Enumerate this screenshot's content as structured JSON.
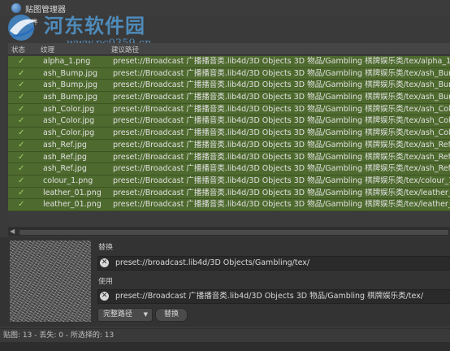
{
  "window": {
    "title": "贴图管理器",
    "menu": "文件"
  },
  "watermark": {
    "title": "河东软件园",
    "url": "www.pc0359.cn"
  },
  "table": {
    "columns": [
      "状态",
      "纹理",
      "建议路径"
    ],
    "rows": [
      {
        "file": "alpha_1.png",
        "path": "preset://Broadcast 广播播音类.lib4d/3D Objects 3D 物品/Gambling 棋牌娱乐类/tex/alpha_1.p"
      },
      {
        "file": "ash_Bump.jpg",
        "path": "preset://Broadcast 广播播音类.lib4d/3D Objects 3D 物品/Gambling 棋牌娱乐类/tex/ash_Bump"
      },
      {
        "file": "ash_Bump.jpg",
        "path": "preset://Broadcast 广播播音类.lib4d/3D Objects 3D 物品/Gambling 棋牌娱乐类/tex/ash_Bump"
      },
      {
        "file": "ash_Bump.jpg",
        "path": "preset://Broadcast 广播播音类.lib4d/3D Objects 3D 物品/Gambling 棋牌娱乐类/tex/ash_Bump"
      },
      {
        "file": "ash_Color.jpg",
        "path": "preset://Broadcast 广播播音类.lib4d/3D Objects 3D 物品/Gambling 棋牌娱乐类/tex/ash_Color"
      },
      {
        "file": "ash_Color.jpg",
        "path": "preset://Broadcast 广播播音类.lib4d/3D Objects 3D 物品/Gambling 棋牌娱乐类/tex/ash_Color"
      },
      {
        "file": "ash_Color.jpg",
        "path": "preset://Broadcast 广播播音类.lib4d/3D Objects 3D 物品/Gambling 棋牌娱乐类/tex/ash_Color"
      },
      {
        "file": "ash_Ref.jpg",
        "path": "preset://Broadcast 广播播音类.lib4d/3D Objects 3D 物品/Gambling 棋牌娱乐类/tex/ash_Ref.jp"
      },
      {
        "file": "ash_Ref.jpg",
        "path": "preset://Broadcast 广播播音类.lib4d/3D Objects 3D 物品/Gambling 棋牌娱乐类/tex/ash_Ref.jp"
      },
      {
        "file": "ash_Ref.jpg",
        "path": "preset://Broadcast 广播播音类.lib4d/3D Objects 3D 物品/Gambling 棋牌娱乐类/tex/ash_Ref.jp"
      },
      {
        "file": "colour_1.png",
        "path": "preset://Broadcast 广播播音类.lib4d/3D Objects 3D 物品/Gambling 棋牌娱乐类/tex/colour_1.p"
      },
      {
        "file": "leather_01.png",
        "path": "preset://Broadcast 广播播音类.lib4d/3D Objects 3D 物品/Gambling 棋牌娱乐类/tex/leather_01"
      },
      {
        "file": "leather_01.png",
        "path": "preset://Broadcast 广播播音类.lib4d/3D Objects 3D 物品/Gambling 棋牌娱乐类/tex/leather_01"
      }
    ]
  },
  "replace": {
    "label": "替换",
    "value": "preset://broadcast.lib4d/3D Objects/Gambling/tex/"
  },
  "with": {
    "label": "使用",
    "value": "preset://Broadcast 广播播音类.lib4d/3D Objects 3D 物品/Gambling 棋牌娱乐类/tex/"
  },
  "controls": {
    "mode": "完整路径",
    "replace_button": "替换"
  },
  "status": "贴图: 13 - 丢失: 0 - 所选择的: 13",
  "colors": {
    "row_ok": "#4e6a2e",
    "check": "#9fd06a",
    "watermark": "#58aaeb"
  }
}
